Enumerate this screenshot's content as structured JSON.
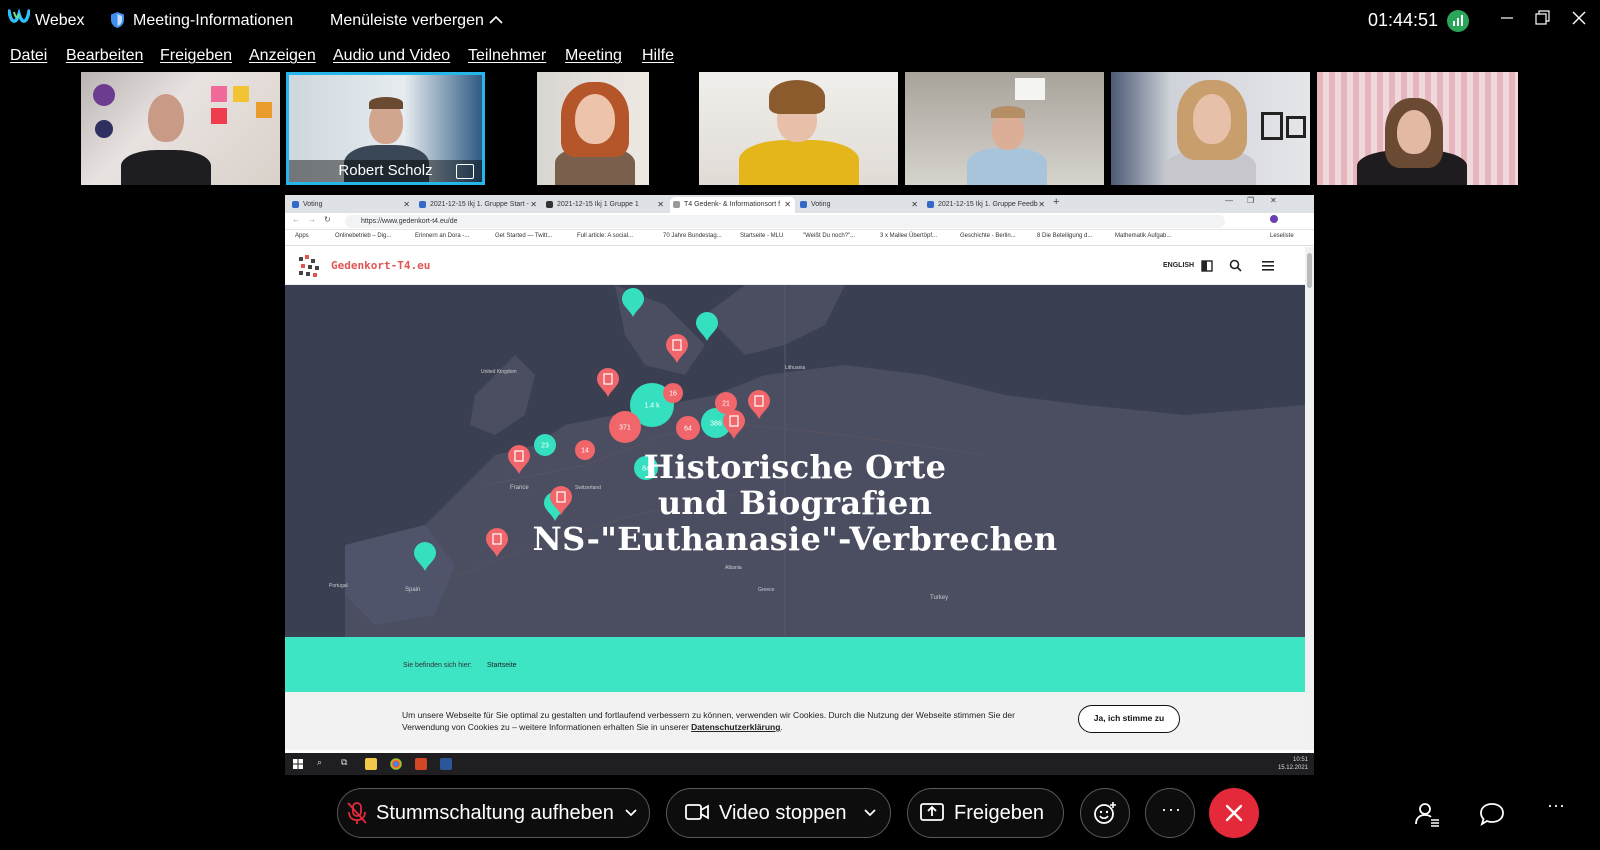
{
  "app": {
    "name": "Webex",
    "meeting_info": "Meeting-Informationen",
    "hide_menu": "Menüleiste verbergen",
    "timer": "01:44:51"
  },
  "menu": [
    "Datei",
    "Bearbeiten",
    "Freigeben",
    "Anzeigen",
    "Audio und Video",
    "Teilnehmer",
    "Meeting",
    "Hilfe"
  ],
  "participants": [
    {
      "name": ""
    },
    {
      "name": "Robert Scholz",
      "active": true
    },
    {
      "name": ""
    },
    {
      "name": ""
    },
    {
      "name": ""
    },
    {
      "name": ""
    },
    {
      "name": ""
    }
  ],
  "browser": {
    "tabs": [
      {
        "title": "Voting"
      },
      {
        "title": "2021-12-15 Ikj 1. Gruppe Start -"
      },
      {
        "title": "2021-12-15 Ikj 1 Gruppe 1"
      },
      {
        "title": "T4 Gedenk- & Informationsort f"
      },
      {
        "title": "Voting"
      },
      {
        "title": "2021-12-15 Ikj 1. Gruppe Feedb"
      }
    ],
    "url": "https://www.gedenkort-t4.eu/de",
    "bookmarks": [
      "Apps",
      "Onlinebetrieb – Dig...",
      "Erinnern an Dora -...",
      "Get Started — Twitt...",
      "Full article: A social...",
      "70 Jahre Bundestag...",
      "Startseite - MLU",
      "\"Weißt Du noch?\"...",
      "3 x Mallee Übertöpf...",
      "Geschichte - Berlin...",
      "8 Die Beteiligung d...",
      "Mathematik Aufgab...",
      "Leseliste"
    ]
  },
  "website": {
    "site_name": "Gedenkort-T4.eu",
    "lang_link": "ENGLISH",
    "hero_lines": [
      "Historische Orte",
      "und Biografien",
      "NS-\"Euthanasie\"-Verbrechen"
    ],
    "breadcrumb_label": "Sie befinden sich hier:",
    "breadcrumb_value": "Startseite",
    "cookie_text_1": "Um unsere Webseite für Sie optimal zu gestalten und fortlaufend verbessern zu können, verwenden wir Cookies. Durch die Nutzung der Webseite stimmen Sie der Verwendung von Cookies zu – weitere Informationen erhalten Sie in unserer ",
    "cookie_link": "Datenschutzerklärung",
    "cookie_button": "Ja, ich stimme zu",
    "map_labels": [
      "United Kingdom",
      "France",
      "Spain",
      "Portugal",
      "Switzerland",
      "Albania",
      "Greece",
      "Turkey",
      "Lithuania"
    ],
    "markers": [
      "1.4 k",
      "386",
      "371",
      "64",
      "84",
      "23",
      "21",
      "16",
      "14"
    ]
  },
  "taskbar": {
    "time": "10:51",
    "date": "15.12.2021"
  },
  "controls": {
    "unmute": "Stummschaltung aufheben",
    "stop_video": "Video stoppen",
    "share": "Freigeben"
  }
}
